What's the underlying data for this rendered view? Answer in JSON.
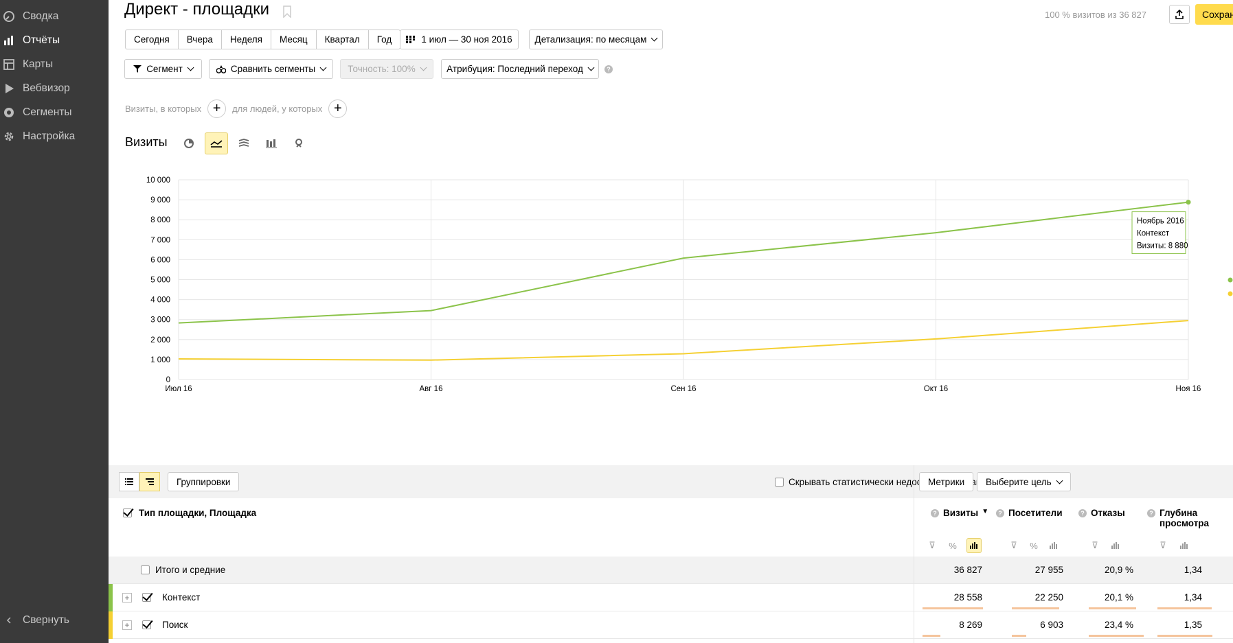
{
  "sidebar": {
    "items": [
      {
        "label": "Сводка",
        "icon": "gauge-icon"
      },
      {
        "label": "Отчёты",
        "icon": "bar-chart-icon",
        "active": true
      },
      {
        "label": "Карты",
        "icon": "map-layout-icon"
      },
      {
        "label": "Вебвизор",
        "icon": "play-icon"
      },
      {
        "label": "Сегменты",
        "icon": "segments-icon"
      },
      {
        "label": "Настройка",
        "icon": "gear-icon"
      }
    ],
    "collapse_label": "Свернуть"
  },
  "header": {
    "title": "Директ - площадки",
    "visits_info": "100 % визитов из 36 827",
    "save_label": "Сохранить"
  },
  "periods": [
    "Сегодня",
    "Вчера",
    "Неделя",
    "Месяц",
    "Квартал",
    "Год"
  ],
  "date_range": "1 июл — 30 ноя 2016",
  "detail": "Детализация: по месяцам",
  "segment": "Сегмент",
  "compare": "Сравнить сегменты",
  "accuracy": "Точность: 100%",
  "attribution": "Атрибуция: Последний переход",
  "filters": {
    "visits_label": "Визиты, в которых",
    "people_label": "для людей, у которых"
  },
  "chart_header": {
    "title": "Визиты",
    "types": [
      "pie-chart-icon",
      "line-chart-icon",
      "stacked-area-icon",
      "bar-chart-icon",
      "map-pin-icon"
    ]
  },
  "chart_data": {
    "type": "line",
    "x": [
      "Июл 16",
      "Авг 16",
      "Сен 16",
      "Окт 16",
      "Ноя 16"
    ],
    "ylim": [
      0,
      10000
    ],
    "yticks": [
      "0",
      "1 000",
      "2 000",
      "3 000",
      "4 000",
      "5 000",
      "6 000",
      "7 000",
      "8 000",
      "9 000",
      "10 000"
    ],
    "grid": true,
    "series": [
      {
        "name": "Контекст",
        "color": "#8bc34a",
        "values": [
          2830,
          3450,
          6080,
          7350,
          8880
        ]
      },
      {
        "name": "Поиск",
        "color": "#f5d033",
        "values": [
          1030,
          970,
          1290,
          2030,
          2950
        ]
      }
    ],
    "tooltip": {
      "title": "Ноябрь 2016",
      "series": "Контекст",
      "text": "Визиты: 8 880"
    }
  },
  "table": {
    "toolbar": {
      "groupings_label": "Группировки",
      "hide_label": "Скрывать статистически недостоверные данные",
      "metrics_label": "Метрики",
      "goal_label": "Выберите цель"
    },
    "dim_header": "Тип площадки, Площадка",
    "columns": [
      "Визиты",
      "Посетители",
      "Отказы",
      "Глубина просмотра"
    ],
    "sort_marker": "▼",
    "total": {
      "label": "Итого и средние",
      "values": [
        "36 827",
        "27 955",
        "20,9 %",
        "1,34"
      ]
    },
    "rows": [
      {
        "label": "Контекст",
        "color": "#8bc34a",
        "values": [
          "28 558",
          "22 250",
          "20,1 %",
          "1,34"
        ],
        "bars": [
          1.0,
          0.78,
          0.86,
          0.99
        ]
      },
      {
        "label": "Поиск",
        "color": "#f5d033",
        "values": [
          "8 269",
          "6 903",
          "23,4 %",
          "1,35"
        ],
        "bars": [
          0.29,
          0.24,
          1.0,
          1.0
        ]
      }
    ]
  }
}
